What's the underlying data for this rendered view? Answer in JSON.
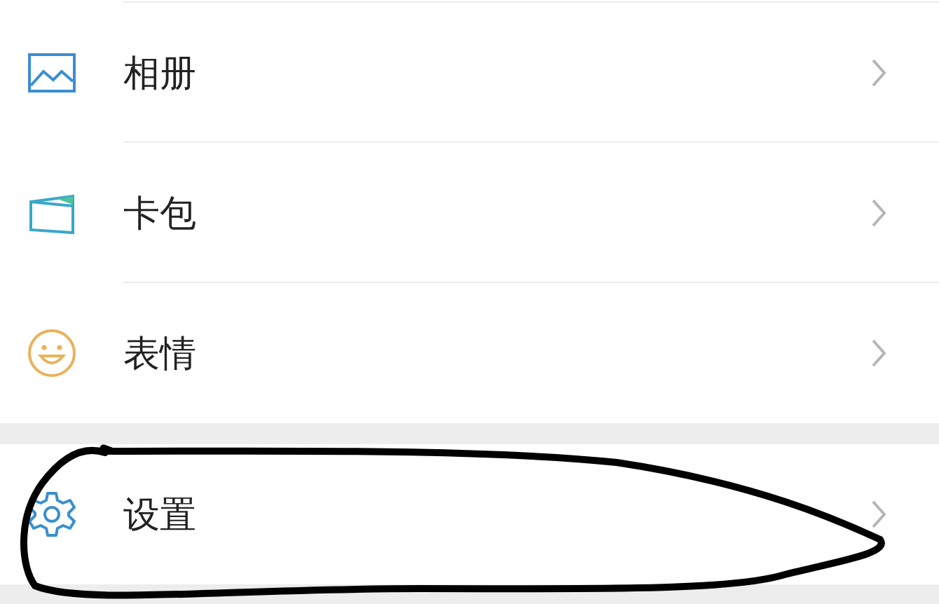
{
  "groups": [
    {
      "items": [
        {
          "kind": "album",
          "label": "相册"
        },
        {
          "kind": "card",
          "label": "卡包"
        },
        {
          "kind": "emoji",
          "label": "表情"
        }
      ]
    },
    {
      "items": [
        {
          "kind": "settings",
          "label": "设置"
        }
      ]
    }
  ],
  "annotation": {
    "kind": "scribble"
  }
}
